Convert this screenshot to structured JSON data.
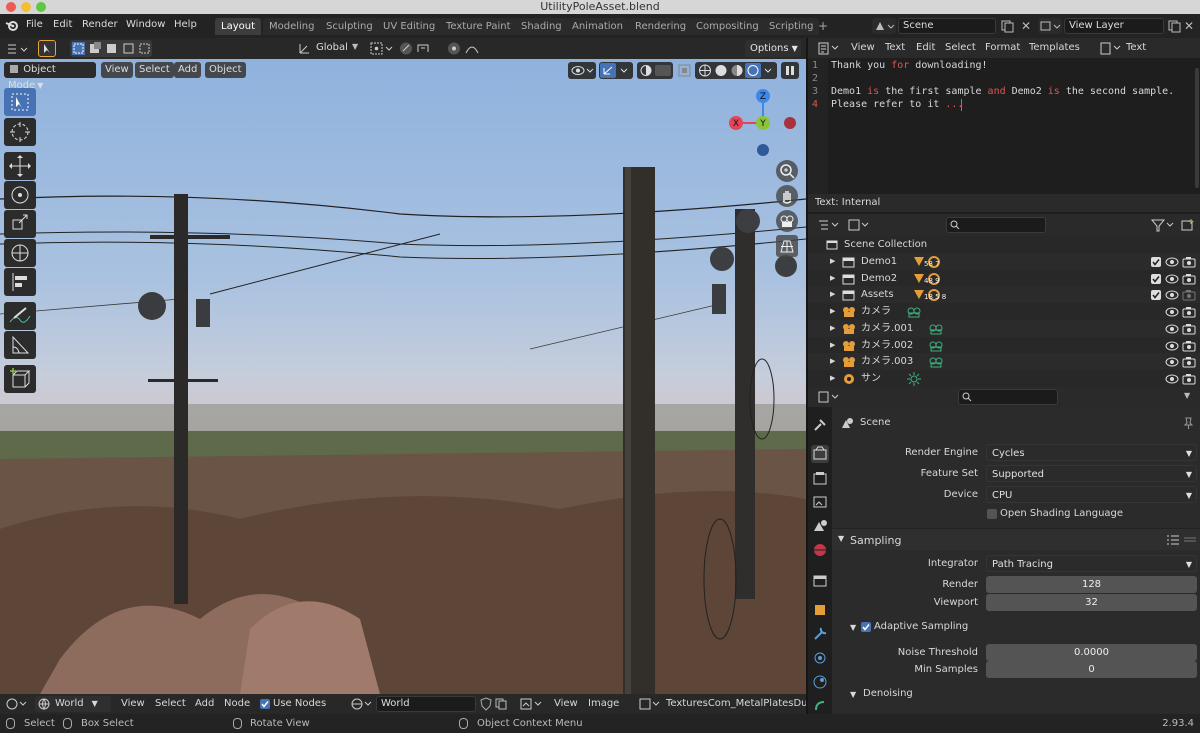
{
  "window": {
    "title": "UtilityPoleAsset.blend"
  },
  "menu": [
    "File",
    "Edit",
    "Render",
    "Window",
    "Help"
  ],
  "workspaces": [
    "Layout",
    "Modeling",
    "Sculpting",
    "UV Editing",
    "Texture Paint",
    "Shading",
    "Animation",
    "Rendering",
    "Compositing",
    "Scripting"
  ],
  "scene_field": "Scene",
  "view_layer_field": "View Layer",
  "viewport": {
    "transform_orientation": "Global",
    "options": "Options",
    "mode": "Object Mode",
    "header_menus": [
      "View",
      "Select",
      "Add",
      "Object"
    ]
  },
  "text_editor": {
    "menus": [
      "View",
      "Text",
      "Edit",
      "Select",
      "Format",
      "Templates"
    ],
    "datablock": "Text",
    "lines": [
      {
        "n": "1",
        "parts": [
          {
            "t": "Thank you ",
            "c": "#d8d8d8"
          },
          {
            "t": "for",
            "c": "#e05555"
          },
          {
            "t": " downloading!",
            "c": "#d8d8d8"
          }
        ]
      },
      {
        "n": "2",
        "parts": []
      },
      {
        "n": "3",
        "parts": [
          {
            "t": "Demo1 ",
            "c": "#d8d8d8"
          },
          {
            "t": "is",
            "c": "#e05555"
          },
          {
            "t": " the first sample ",
            "c": "#d8d8d8"
          },
          {
            "t": "and",
            "c": "#e05555"
          },
          {
            "t": " Demo2 ",
            "c": "#d8d8d8"
          },
          {
            "t": "is",
            "c": "#e05555"
          },
          {
            "t": " the second sample.",
            "c": "#d8d8d8"
          }
        ]
      },
      {
        "n": "4",
        "parts": [
          {
            "t": "Please refer to it ",
            "c": "#d8d8d8"
          },
          {
            "t": "...",
            "c": "#e05555"
          }
        ]
      }
    ],
    "footer": "Text: Internal"
  },
  "outliner": {
    "root": "Scene Collection",
    "rows": [
      {
        "name": "Demo1",
        "type": "collection",
        "badges": "58 7",
        "vis": true
      },
      {
        "name": "Demo2",
        "type": "collection",
        "badges": "48 9",
        "vis": true
      },
      {
        "name": "Assets",
        "type": "collection",
        "badges": "18 5 8",
        "vis": true
      },
      {
        "name": "カメラ",
        "type": "camera",
        "badges": "",
        "vis": false
      },
      {
        "name": "カメラ.001",
        "type": "camera",
        "badges": "",
        "vis": false
      },
      {
        "name": "カメラ.002",
        "type": "camera",
        "badges": "",
        "vis": false
      },
      {
        "name": "カメラ.003",
        "type": "camera",
        "badges": "",
        "vis": false
      },
      {
        "name": "サン",
        "type": "light",
        "badges": "",
        "vis": false
      }
    ]
  },
  "properties": {
    "context": "Scene",
    "render_engine_label": "Render Engine",
    "render_engine": "Cycles",
    "feature_set_label": "Feature Set",
    "feature_set": "Supported",
    "device_label": "Device",
    "device": "CPU",
    "osl_label": "Open Shading Language",
    "sampling_title": "Sampling",
    "integrator_label": "Integrator",
    "integrator": "Path Tracing",
    "render_label": "Render",
    "render_samples": "128",
    "viewport_label": "Viewport",
    "viewport_samples": "32",
    "adaptive_label": "Adaptive Sampling",
    "noise_label": "Noise Threshold",
    "noise_value": "0.0000",
    "min_samples_label": "Min Samples",
    "min_samples_value": "0",
    "denoising_title": "Denoising"
  },
  "bottom_header": {
    "world_dropdown": "World",
    "menus": [
      "View",
      "Select",
      "Add",
      "Node"
    ],
    "use_nodes": "Use Nodes",
    "world_field": "World",
    "image_menus": [
      "View",
      "Image"
    ],
    "image_name": "TexturesCom_MetalPlatesDucts"
  },
  "statusbar": {
    "select": "Select",
    "box_select": "Box Select",
    "rotate_view": "Rotate View",
    "context_menu": "Object Context Menu",
    "version": "2.93.4"
  },
  "colors": {
    "accent": "#4772b3",
    "axis_x": "#e44556",
    "axis_y": "#8ac43c",
    "axis_z": "#3d88e8",
    "outliner_orange": "#e59d3a",
    "camera_green": "#3fb07f"
  }
}
